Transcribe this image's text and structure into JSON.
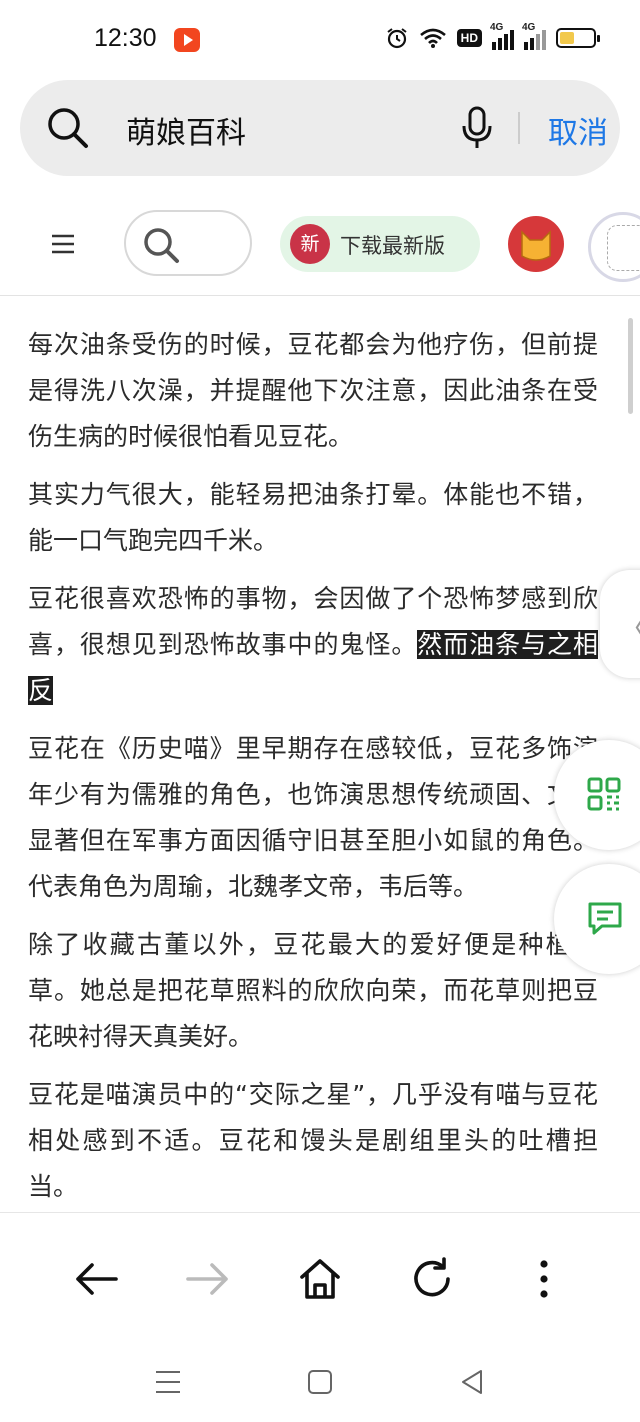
{
  "status_bar": {
    "time": "12:30",
    "network_label": "HD",
    "signal_labels": [
      "4G",
      "4G"
    ]
  },
  "search": {
    "query": "萌娘百科",
    "cancel_label": "取消"
  },
  "site_header": {
    "new_badge": "新",
    "download_label": "下载最新版"
  },
  "article": {
    "paragraphs": [
      {
        "text": "每次油条受伤的时候，豆花都会为他疗伤，但前提是得洗八次澡，并提醒他下次注意，因此油条在受伤生病的时候很怕看见豆花。"
      },
      {
        "text": "其实力气很大，能轻易把油条打晕。体能也不错，能一口气跑完四千米。"
      },
      {
        "text": "豆花很喜欢恐怖的事物，会因做了个恐怖梦感到欣喜，很想见到恐怖故事中的鬼怪。",
        "highlight": "然而油条与之相反"
      },
      {
        "text": "豆花在《历史喵》里早期存在感较低，豆花多饰演年少有为儒雅的角色，也饰演思想传统顽固、文治显著但在军事方面因循守旧甚至胆小如鼠的角色。代表角色为周瑜，北魏孝文帝，韦后等。"
      },
      {
        "text": "除了收藏古董以外，豆花最大的爱好便是种植花草。她总是把花草照料的欣欣向荣，而花草则把豆花映衬得天真美好。"
      },
      {
        "text": "豆花是喵演员中的“交际之星”，几乎没有喵与豆花相处感到不适。豆花和馒头是剧组里头的吐槽担当。"
      }
    ]
  },
  "floating": {
    "side_tab_glyph": "〈"
  },
  "icons": {
    "accent_color": "#1e78e6",
    "float_icon_color": "#2ea84a",
    "badge_color": "#c93347"
  }
}
